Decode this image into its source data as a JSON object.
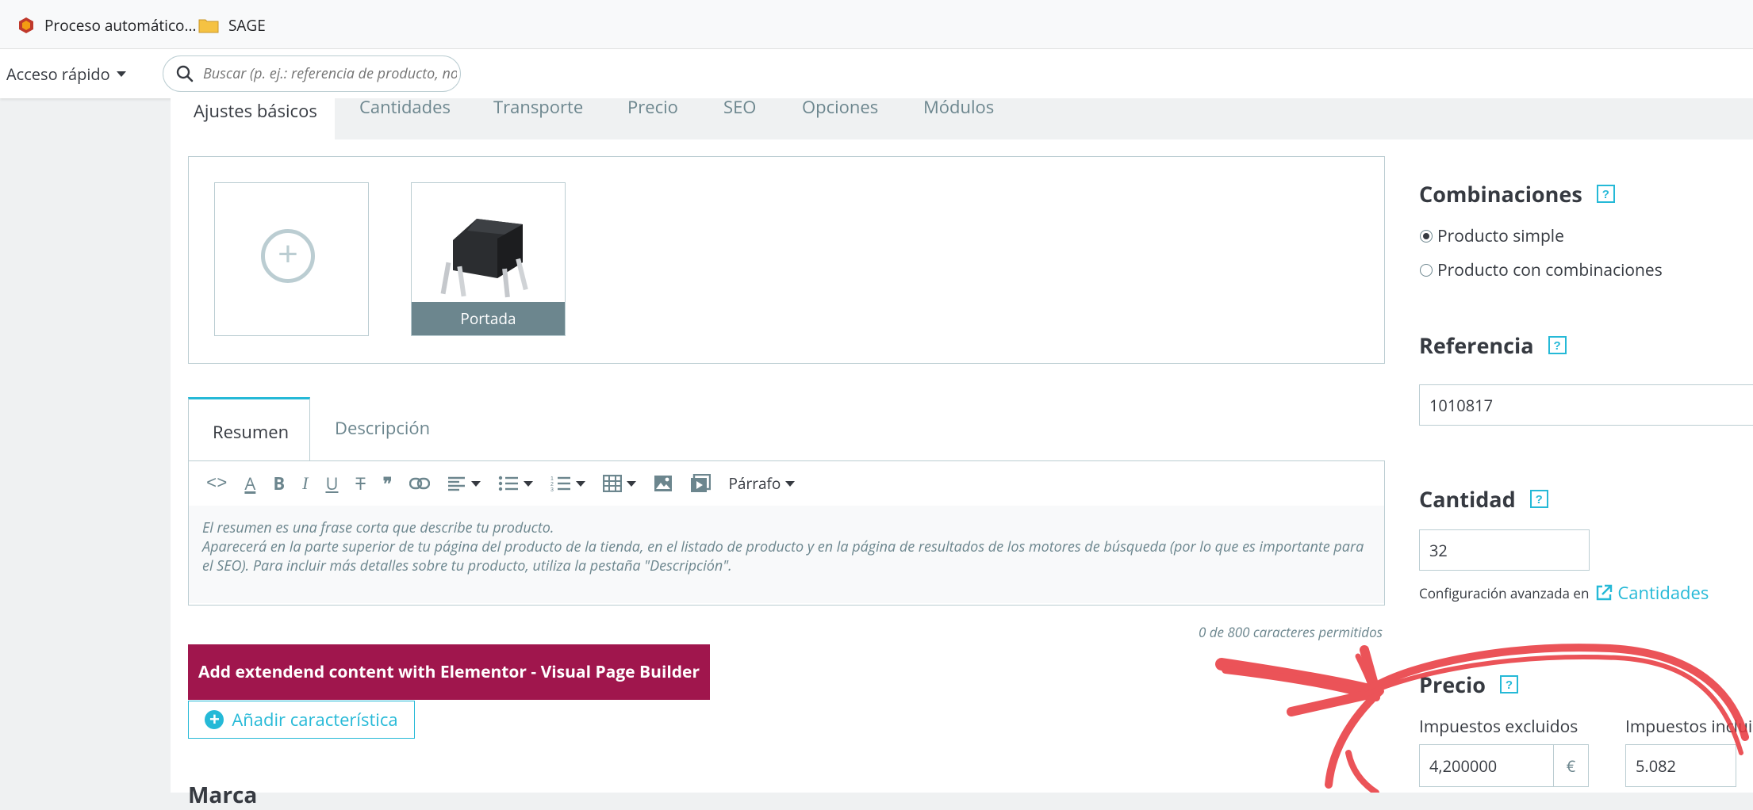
{
  "bookmarks": [
    {
      "label": "Proceso automático..."
    },
    {
      "label": "SAGE"
    }
  ],
  "header": {
    "quick_access": "Acceso rápido",
    "search_placeholder": "Buscar (p. ej.: referencia de producto, no"
  },
  "tabs": [
    {
      "label": "Ajustes básicos",
      "active": true
    },
    {
      "label": "Cantidades"
    },
    {
      "label": "Transporte"
    },
    {
      "label": "Precio"
    },
    {
      "label": "SEO"
    },
    {
      "label": "Opciones"
    },
    {
      "label": "Módulos"
    }
  ],
  "images": {
    "cover_label": "Portada"
  },
  "summary": {
    "tabs": [
      "Resumen",
      "Descripción"
    ],
    "format_select": "Párrafo",
    "placeholder_line1": "El resumen es una frase corta que describe tu producto.",
    "placeholder_line2": "Aparecerá en la parte superior de tu página del producto de la tienda, en el listado de producto y en la página de resultados de los motores de búsqueda (por lo que es importante para el SEO). Para incluir más detalles sobre tu producto, utiliza la pestaña \"Descripción\".",
    "counter": "0 de 800 caracteres permitidos"
  },
  "buttons": {
    "elementor": "Add extendend content with Elementor - Visual Page Builder",
    "add_feature": "Añadir característica"
  },
  "marca_heading": "Marca",
  "right": {
    "combinations_title": "Combinaciones",
    "simple_product": "Producto simple",
    "with_combinations": "Producto con combinaciones",
    "reference_title": "Referencia",
    "reference_value": "1010817",
    "quantity_title": "Cantidad",
    "quantity_value": "32",
    "advanced_prefix": "Configuración avanzada en",
    "advanced_link": "Cantidades",
    "price_title": "Precio",
    "tax_excluded_label": "Impuestos excluidos",
    "tax_excluded_value": "4,200000",
    "currency": "€",
    "tax_included_label": "Impuestos inclui",
    "tax_included_value": "5.082"
  },
  "colors": {
    "accent": "#25b9d7",
    "elementor": "#a0164d",
    "annotation": "#e8363c"
  },
  "help_icon": "?"
}
